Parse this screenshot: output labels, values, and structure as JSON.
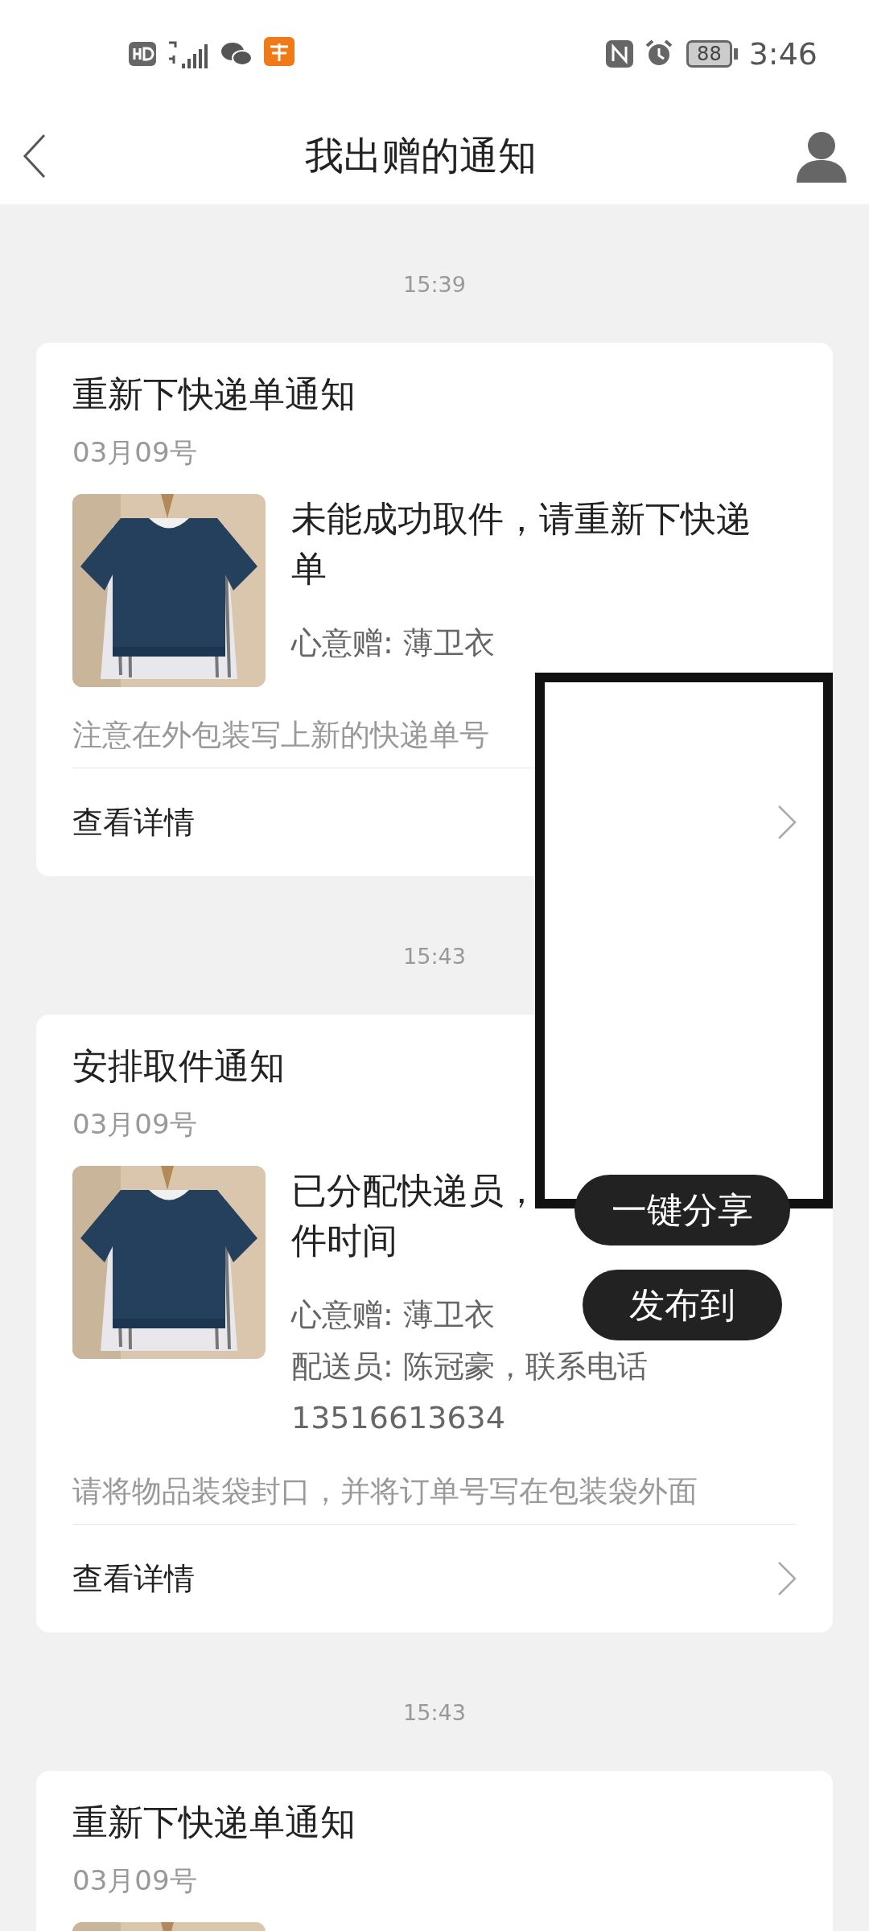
{
  "status_bar": {
    "battery": "88",
    "time": "3:46"
  },
  "header": {
    "title": "我出赠的通知"
  },
  "notifications": [
    {
      "timestamp": "15:39",
      "title": "重新下快递单通知",
      "date": "03月09号",
      "message_lines": [
        "未能成功取件，请重新下快递",
        "单"
      ],
      "info_lines": [
        "心意赠: 薄卫衣"
      ],
      "note": "注意在外包装写上新的快递单号",
      "link": "查看详情"
    },
    {
      "timestamp": "15:43",
      "title": "安排取件通知",
      "date": "03月09号",
      "message_lines": [
        "已分配快递员，",
        "件时间"
      ],
      "info_lines": [
        "心意赠: 薄卫衣",
        "配送员: 陈冠豪，联系电话",
        "13516613634"
      ],
      "note": "请将物品装袋封口，并将订单号写在包装袋外面",
      "link": "查看详情"
    },
    {
      "timestamp": "15:43",
      "title": "重新下快递单通知",
      "date": "03月09号"
    }
  ],
  "share_buttons": [
    "一键分享",
    "发布到"
  ]
}
